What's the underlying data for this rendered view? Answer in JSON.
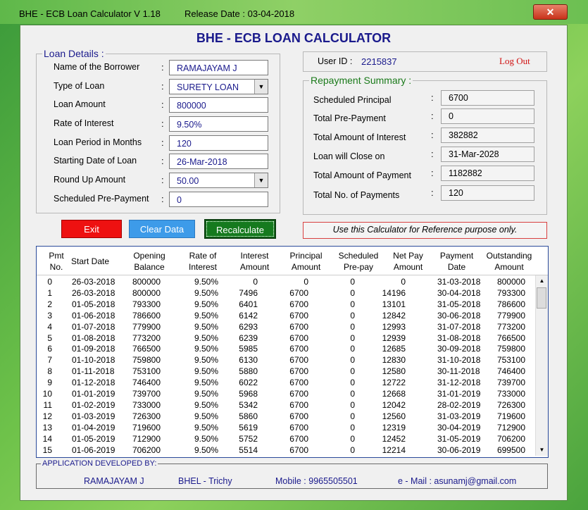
{
  "window": {
    "title": "BHE - ECB Loan Calculator V 1.18",
    "release": "Release Date : 03-04-2018",
    "close_label": "✕"
  },
  "header": {
    "title": "BHE - ECB LOAN CALCULATOR"
  },
  "loan_details": {
    "legend": "Loan Details :",
    "fields": [
      {
        "label": "Name of the Borrower",
        "value": "RAMAJAYAM J"
      },
      {
        "label": "Type of Loan",
        "value": "SURETY LOAN"
      },
      {
        "label": "Loan Amount",
        "value": "800000"
      },
      {
        "label": "Rate of Interest",
        "value": "9.50%"
      },
      {
        "label": "Loan Period in Months",
        "value": "120"
      },
      {
        "label": "Starting Date of Loan",
        "value": "26-Mar-2018"
      },
      {
        "label": "Round Up Amount",
        "value": "50.00"
      },
      {
        "label": "Scheduled Pre-Payment",
        "value": "0"
      }
    ]
  },
  "user": {
    "label": "User ID :",
    "id": "2215837",
    "logout": "Log Out"
  },
  "summary": {
    "legend": "Repayment Summary  :",
    "items": [
      {
        "label": "Scheduled Principal",
        "value": "6700"
      },
      {
        "label": "Total Pre-Payment",
        "value": "0"
      },
      {
        "label": "Total Amount of Interest",
        "value": "382882"
      },
      {
        "label": "Loan will Close on",
        "value": "31-Mar-2028"
      },
      {
        "label": "Total Amount of Payment",
        "value": "1182882"
      },
      {
        "label": "Total No. of Payments",
        "value": "120"
      }
    ]
  },
  "buttons": {
    "exit": "Exit",
    "clear": "Clear Data",
    "recalc": "Recalculate"
  },
  "notice": "Use this Calculator for Reference purpose only.",
  "table": {
    "headers": [
      [
        "Pmt",
        "No."
      ],
      [
        "Start Date",
        ""
      ],
      [
        "Opening",
        "Balance"
      ],
      [
        "Rate of",
        "Interest"
      ],
      [
        "Interest",
        "Amount"
      ],
      [
        "Principal",
        "Amount"
      ],
      [
        "Scheduled",
        "Pre-pay"
      ],
      [
        "Net Pay",
        "Amount"
      ],
      [
        "Payment",
        "Date"
      ],
      [
        "Outstanding",
        "Amount"
      ]
    ],
    "rows": [
      [
        "0",
        "26-03-2018",
        "800000",
        "9.50%",
        "0",
        "0",
        "0",
        "0",
        "31-03-2018",
        "800000"
      ],
      [
        "1",
        "26-03-2018",
        "800000",
        "9.50%",
        "7496",
        "6700",
        "0",
        "14196",
        "30-04-2018",
        "793300"
      ],
      [
        "2",
        "01-05-2018",
        "793300",
        "9.50%",
        "6401",
        "6700",
        "0",
        "13101",
        "31-05-2018",
        "786600"
      ],
      [
        "3",
        "01-06-2018",
        "786600",
        "9.50%",
        "6142",
        "6700",
        "0",
        "12842",
        "30-06-2018",
        "779900"
      ],
      [
        "4",
        "01-07-2018",
        "779900",
        "9.50%",
        "6293",
        "6700",
        "0",
        "12993",
        "31-07-2018",
        "773200"
      ],
      [
        "5",
        "01-08-2018",
        "773200",
        "9.50%",
        "6239",
        "6700",
        "0",
        "12939",
        "31-08-2018",
        "766500"
      ],
      [
        "6",
        "01-09-2018",
        "766500",
        "9.50%",
        "5985",
        "6700",
        "0",
        "12685",
        "30-09-2018",
        "759800"
      ],
      [
        "7",
        "01-10-2018",
        "759800",
        "9.50%",
        "6130",
        "6700",
        "0",
        "12830",
        "31-10-2018",
        "753100"
      ],
      [
        "8",
        "01-11-2018",
        "753100",
        "9.50%",
        "5880",
        "6700",
        "0",
        "12580",
        "30-11-2018",
        "746400"
      ],
      [
        "9",
        "01-12-2018",
        "746400",
        "9.50%",
        "6022",
        "6700",
        "0",
        "12722",
        "31-12-2018",
        "739700"
      ],
      [
        "10",
        "01-01-2019",
        "739700",
        "9.50%",
        "5968",
        "6700",
        "0",
        "12668",
        "31-01-2019",
        "733000"
      ],
      [
        "11",
        "01-02-2019",
        "733000",
        "9.50%",
        "5342",
        "6700",
        "0",
        "12042",
        "28-02-2019",
        "726300"
      ],
      [
        "12",
        "01-03-2019",
        "726300",
        "9.50%",
        "5860",
        "6700",
        "0",
        "12560",
        "31-03-2019",
        "719600"
      ],
      [
        "13",
        "01-04-2019",
        "719600",
        "9.50%",
        "5619",
        "6700",
        "0",
        "12319",
        "30-04-2019",
        "712900"
      ],
      [
        "14",
        "01-05-2019",
        "712900",
        "9.50%",
        "5752",
        "6700",
        "0",
        "12452",
        "31-05-2019",
        "706200"
      ],
      [
        "15",
        "01-06-2019",
        "706200",
        "9.50%",
        "5514",
        "6700",
        "0",
        "12214",
        "30-06-2019",
        "699500"
      ]
    ]
  },
  "footer": {
    "legend": "APPLICATION DEVELOPED BY:",
    "name": "RAMAJAYAM J",
    "org": "BHEL - Trichy",
    "mobile": "Mobile : 9965505501",
    "email": "e - Mail : asunamj@gmail.com"
  },
  "colors": {
    "title_blue": "#1a1a8c",
    "exit_red": "#ee1111",
    "clear_blue": "#3d9be9",
    "recalc_green": "#157a1e",
    "logout_red": "#d01010"
  }
}
